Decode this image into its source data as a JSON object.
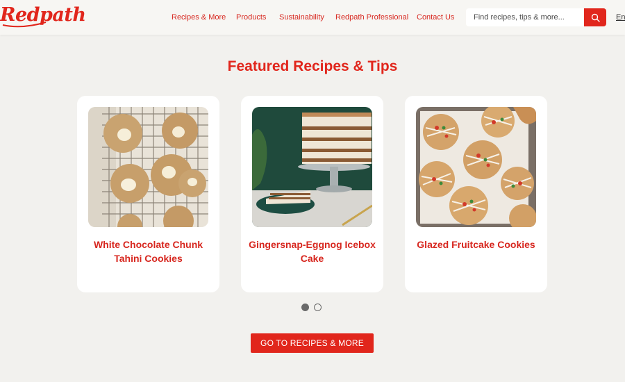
{
  "brand": {
    "logo_text": "Redpath",
    "accent_color": "#e1261c"
  },
  "nav": {
    "items": [
      {
        "label": "Recipes & More"
      },
      {
        "label": "Products"
      },
      {
        "label": "Sustainability"
      },
      {
        "label": "Redpath Professional"
      },
      {
        "label": "Contact Us"
      }
    ]
  },
  "search": {
    "placeholder": "Find recipes, tips & more...",
    "icon": "search-icon"
  },
  "language": {
    "label": "En"
  },
  "featured": {
    "title": "Featured Recipes & Tips",
    "cards": [
      {
        "title": "White Chocolate Chunk Tahini Cookies"
      },
      {
        "title": "Gingersnap-Eggnog Icebox Cake"
      },
      {
        "title": "Glazed Fruitcake Cookies"
      }
    ],
    "pagination": {
      "current": 1,
      "total": 2
    },
    "cta_label": "GO TO RECIPES & MORE"
  }
}
